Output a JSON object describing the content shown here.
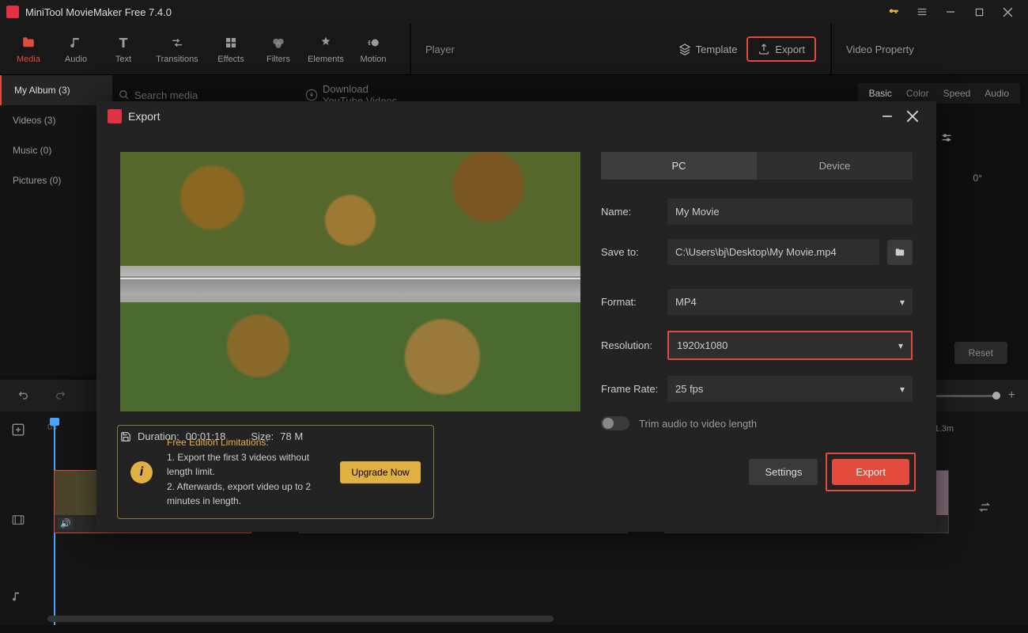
{
  "titlebar": {
    "title": "MiniTool MovieMaker Free 7.4.0"
  },
  "toolbar": {
    "items": [
      {
        "label": "Media"
      },
      {
        "label": "Audio"
      },
      {
        "label": "Text"
      },
      {
        "label": "Transitions"
      },
      {
        "label": "Effects"
      },
      {
        "label": "Filters"
      },
      {
        "label": "Elements"
      },
      {
        "label": "Motion"
      }
    ],
    "player": "Player",
    "template": "Template",
    "export": "Export",
    "video_property": "Video Property"
  },
  "sidebar": {
    "items": [
      {
        "label": "My Album (3)"
      },
      {
        "label": "Videos (3)"
      },
      {
        "label": "Music (0)"
      },
      {
        "label": "Pictures (0)"
      }
    ]
  },
  "search": {
    "placeholder": "Search media",
    "yt": "Download YouTube Videos"
  },
  "proptabs": {
    "basic": "Basic",
    "color": "Color",
    "speed": "Speed",
    "audio": "Audio"
  },
  "right_panel": {
    "rotation": "0°",
    "reset": "Reset"
  },
  "timeline": {
    "start": "0s",
    "mark": "1.3m"
  },
  "modal": {
    "title": "Export",
    "tabs": {
      "pc": "PC",
      "device": "Device"
    },
    "name_label": "Name:",
    "name_value": "My Movie",
    "save_label": "Save to:",
    "save_value": "C:\\Users\\bj\\Desktop\\My Movie.mp4",
    "format_label": "Format:",
    "format_value": "MP4",
    "resolution_label": "Resolution:",
    "resolution_value": "1920x1080",
    "fps_label": "Frame Rate:",
    "fps_value": "25 fps",
    "trim_label": "Trim audio to video length",
    "duration_label": "Duration:",
    "duration_value": "00:01:18",
    "size_label": "Size:",
    "size_value": "78 M",
    "limit_head": "Free Edition Limitations:",
    "limit_1": "1. Export the first 3 videos without length limit.",
    "limit_2": "2. Afterwards, export video up to 2 minutes in length.",
    "upgrade": "Upgrade Now",
    "settings": "Settings",
    "export_btn": "Export"
  }
}
